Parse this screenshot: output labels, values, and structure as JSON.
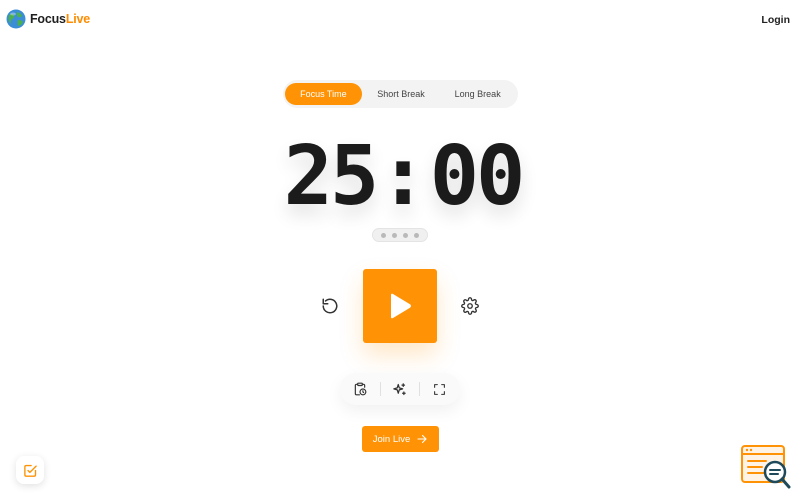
{
  "header": {
    "logo_part1": "Focus",
    "logo_part2": "Live",
    "login_label": "Login"
  },
  "tabs": [
    {
      "label": "Focus Time",
      "active": true
    },
    {
      "label": "Short Break",
      "active": false
    },
    {
      "label": "Long Break",
      "active": false
    }
  ],
  "timer": {
    "minutes": "25",
    "separator": ":",
    "seconds": "00"
  },
  "controls": {
    "reset_icon": "reset-icon",
    "play_icon": "play-icon",
    "settings_icon": "gear-icon"
  },
  "toolbar": {
    "icons": [
      "clipboard-clock-icon",
      "sparkles-icon",
      "fullscreen-icon"
    ]
  },
  "join": {
    "label": "Join Live"
  },
  "colors": {
    "accent": "#ff9305",
    "text": "#1b1b1b",
    "tab_bg": "#f3f3f3"
  }
}
